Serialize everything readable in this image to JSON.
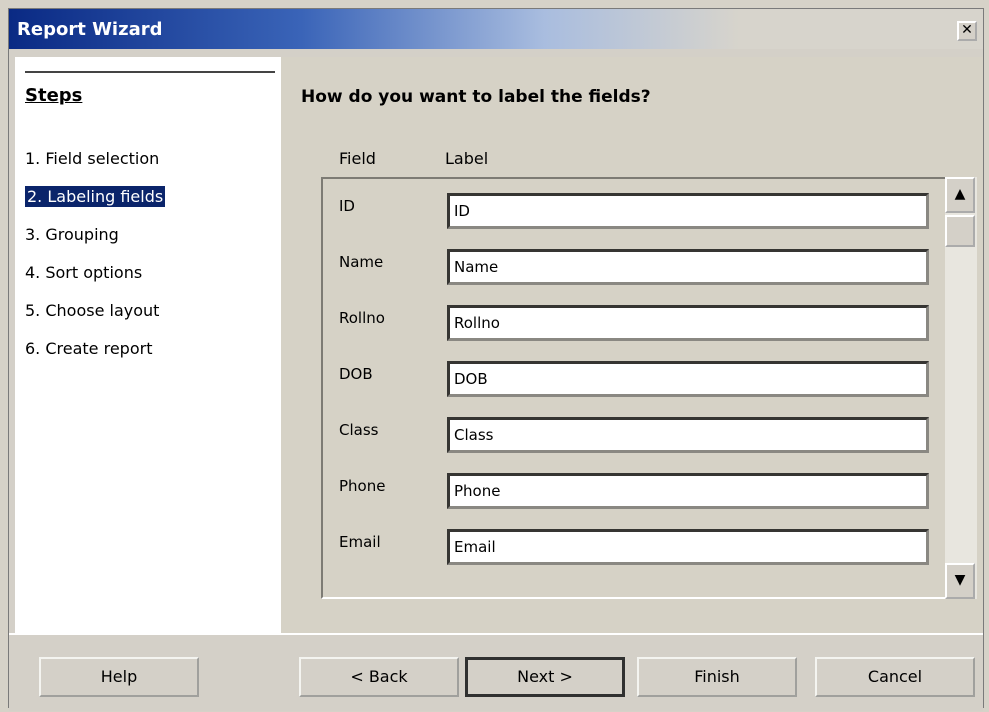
{
  "window": {
    "title": "Report Wizard",
    "close_label": "✕"
  },
  "steps": {
    "heading": "Steps",
    "items": [
      {
        "label": "1. Field selection",
        "active": false
      },
      {
        "label": "2. Labeling fields",
        "active": true
      },
      {
        "label": "3. Grouping",
        "active": false
      },
      {
        "label": "4. Sort options",
        "active": false
      },
      {
        "label": "5. Choose layout",
        "active": false
      },
      {
        "label": "6. Create report",
        "active": false
      }
    ]
  },
  "main": {
    "question": "How do you want to label the fields?",
    "field_header": "Field",
    "label_header": "Label",
    "rows": [
      {
        "field": "ID",
        "label": "ID"
      },
      {
        "field": "Name",
        "label": "Name"
      },
      {
        "field": "Rollno",
        "label": "Rollno"
      },
      {
        "field": "DOB",
        "label": "DOB"
      },
      {
        "field": "Class",
        "label": "Class"
      },
      {
        "field": "Phone",
        "label": "Phone"
      },
      {
        "field": "Email",
        "label": "Email"
      }
    ]
  },
  "buttons": {
    "help": "Help",
    "back": "< Back",
    "next": "Next >",
    "finish": "Finish",
    "cancel": "Cancel"
  }
}
